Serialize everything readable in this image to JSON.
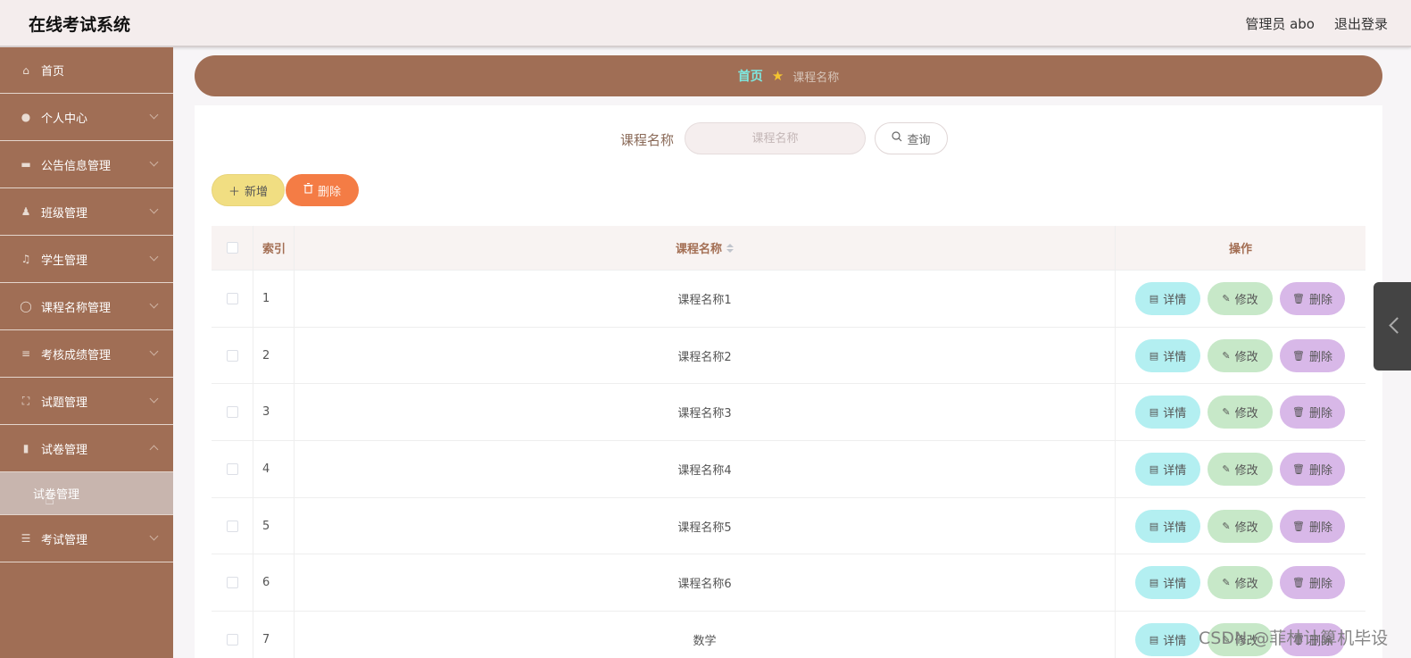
{
  "app": {
    "title": "在线考试系统"
  },
  "header": {
    "user_label": "管理员 abo",
    "logout": "退出登录"
  },
  "sidebar": {
    "items": [
      {
        "label": "首页",
        "icon": "home-icon",
        "chevron": ""
      },
      {
        "label": "个人中心",
        "icon": "user-icon",
        "chevron": "down"
      },
      {
        "label": "公告信息管理",
        "icon": "ticket-icon",
        "chevron": "down"
      },
      {
        "label": "班级管理",
        "icon": "person-stand-icon",
        "chevron": "down"
      },
      {
        "label": "学生管理",
        "icon": "bell-icon",
        "chevron": "down"
      },
      {
        "label": "课程名称管理",
        "icon": "circle-icon",
        "chevron": "down"
      },
      {
        "label": "考核成绩管理",
        "icon": "sliders-icon",
        "chevron": "down"
      },
      {
        "label": "试题管理",
        "icon": "frame-icon",
        "chevron": "down"
      },
      {
        "label": "试卷管理",
        "icon": "chart-icon",
        "chevron": "up"
      }
    ],
    "submenu": {
      "label": "试卷管理"
    },
    "last_item": {
      "label": "考试管理",
      "icon": "list-icon"
    }
  },
  "breadcrumb": {
    "home": "首页",
    "current": "课程名称"
  },
  "search": {
    "label": "课程名称",
    "placeholder": "课程名称",
    "query_button": "查询"
  },
  "toolbar": {
    "add": "新增",
    "delete": "删除"
  },
  "table": {
    "headers": {
      "index": "索引",
      "name": "课程名称",
      "ops": "操作"
    },
    "rows": [
      {
        "index": "1",
        "name": "课程名称1"
      },
      {
        "index": "2",
        "name": "课程名称2"
      },
      {
        "index": "3",
        "name": "课程名称3"
      },
      {
        "index": "4",
        "name": "课程名称4"
      },
      {
        "index": "5",
        "name": "课程名称5"
      },
      {
        "index": "6",
        "name": "课程名称6"
      },
      {
        "index": "7",
        "name": "数学"
      }
    ],
    "actions": {
      "detail": "详情",
      "edit": "修改",
      "delete": "删除"
    }
  },
  "watermark": "CSDN @菲林计算机毕设",
  "colors": {
    "sidebar": "#a06e55",
    "breadcrumb": "#a06e55",
    "add": "#f1de82",
    "delete": "#f47c45",
    "detail": "#b3eff1",
    "edit": "#c7e8c8",
    "row_delete": "#d8b8e8"
  }
}
